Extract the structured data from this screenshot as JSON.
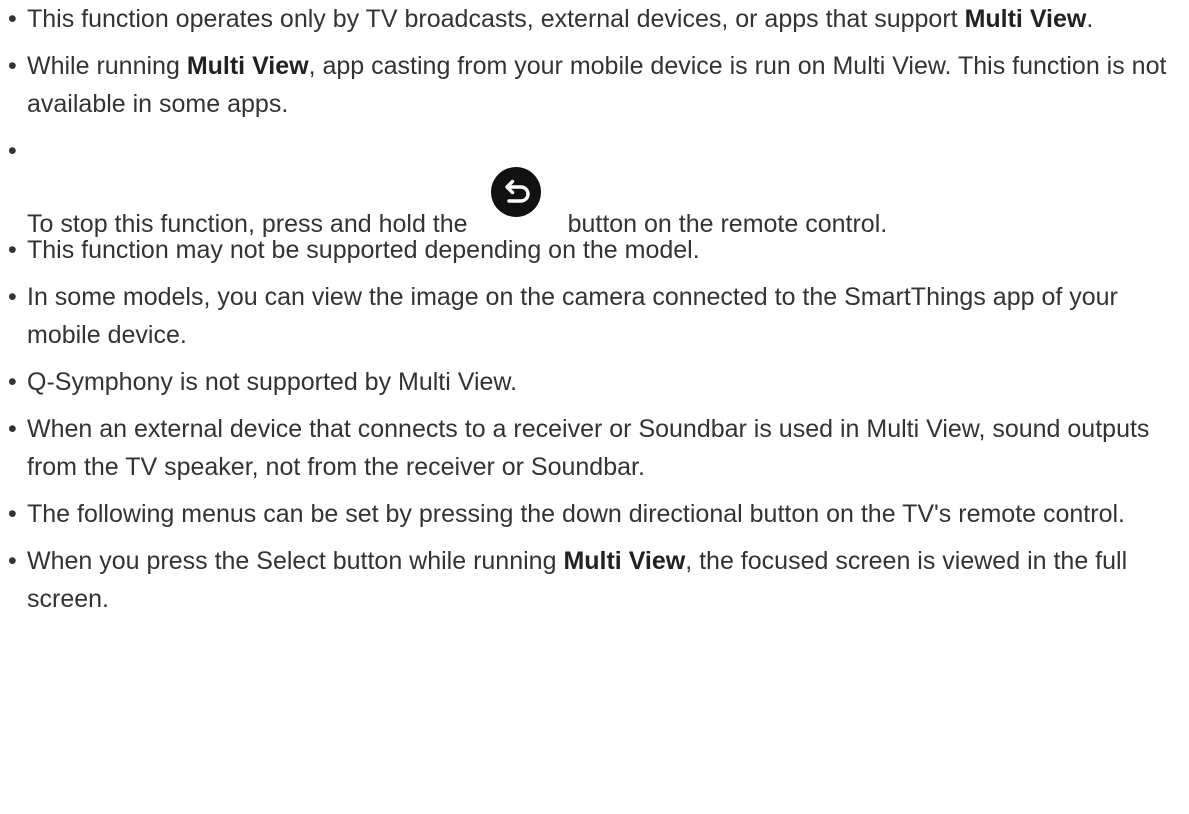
{
  "notes": [
    {
      "before": "This function operates only by TV broadcasts, external devices, or apps that support ",
      "bold": "Multi View",
      "after": "."
    },
    {
      "before": "While running ",
      "bold": "Multi View",
      "after": ", app casting from your mobile device is run on Multi View. This function is not available in some apps."
    },
    {
      "before": "To stop this function, press and hold the",
      "icon": "return-icon",
      "after": "button on the remote control."
    },
    {
      "text": "This function may not be supported depending on the model."
    },
    {
      "text": "In some models, you can view the image on the camera connected to the SmartThings app of your mobile device."
    },
    {
      "text": "Q-Symphony is not supported by Multi View."
    },
    {
      "text": "When an external device that connects to a receiver or Soundbar is used in Multi View, sound outputs from the TV speaker, not from the receiver or Soundbar."
    },
    {
      "text": "The following menus can be set by pressing the down directional button on the TV's remote control."
    },
    {
      "before": "When you press the Select button while running ",
      "bold": "Multi View",
      "after": ", the focused screen is viewed in the full screen."
    }
  ]
}
